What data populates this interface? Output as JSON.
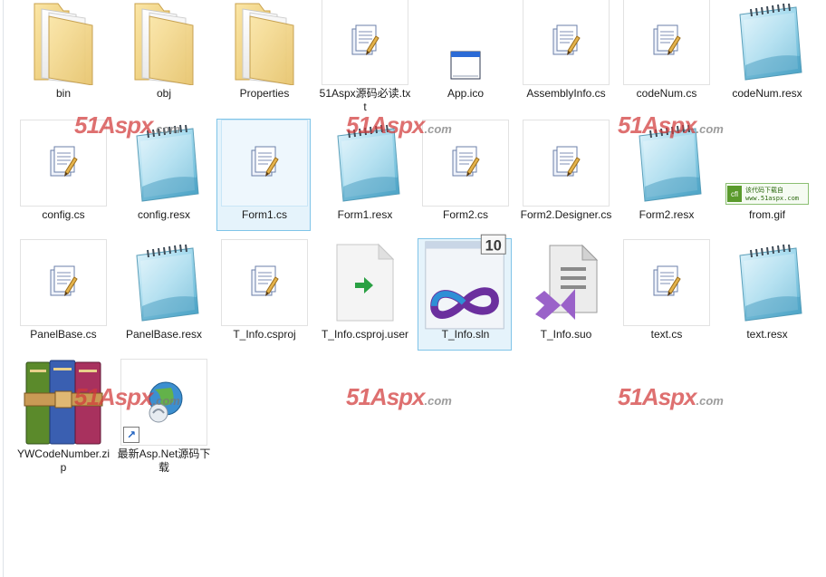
{
  "files": [
    {
      "label": "bin",
      "icon": "folder-icon"
    },
    {
      "label": "obj",
      "icon": "folder-icon"
    },
    {
      "label": "Properties",
      "icon": "folder-icon"
    },
    {
      "label": "51Aspx源码必读.txt",
      "icon": "document-icon"
    },
    {
      "label": "App.ico",
      "icon": "window-icon"
    },
    {
      "label": "AssemblyInfo.cs",
      "icon": "document-icon"
    },
    {
      "label": "codeNum.cs",
      "icon": "document-icon"
    },
    {
      "label": "codeNum.resx",
      "icon": "notepad-icon"
    },
    {
      "label": "config.cs",
      "icon": "document-icon"
    },
    {
      "label": "config.resx",
      "icon": "notepad-icon"
    },
    {
      "label": "Form1.cs",
      "icon": "document-icon"
    },
    {
      "label": "Form1.resx",
      "icon": "notepad-icon"
    },
    {
      "label": "Form2.cs",
      "icon": "document-icon"
    },
    {
      "label": "Form2.Designer.cs",
      "icon": "document-icon"
    },
    {
      "label": "Form2.resx",
      "icon": "notepad-icon"
    },
    {
      "label": "from.gif",
      "icon": "gif-icon",
      "gif_text_top": "该代码下载自",
      "gif_text_bottom": "www.51aspx.com"
    },
    {
      "label": "PanelBase.cs",
      "icon": "document-icon"
    },
    {
      "label": "PanelBase.resx",
      "icon": "notepad-icon"
    },
    {
      "label": "T_Info.csproj",
      "icon": "document-icon"
    },
    {
      "label": "T_Info.csproj.user",
      "icon": "user-file-icon"
    },
    {
      "label": "T_Info.sln",
      "icon": "visual-studio-solution-icon",
      "badge": "10"
    },
    {
      "label": "T_Info.suo",
      "icon": "visual-studio-file-icon"
    },
    {
      "label": "text.cs",
      "icon": "document-icon"
    },
    {
      "label": "text.resx",
      "icon": "notepad-icon"
    },
    {
      "label": "YWCodeNumber.zip",
      "icon": "winrar-icon"
    },
    {
      "label": "最新Asp.Net源码下载",
      "icon": "internet-shortcut-icon"
    }
  ],
  "selected": [
    "Form1.cs",
    "T_Info.sln"
  ],
  "watermark": {
    "main": "51Aspx",
    "suffix": ".com",
    "color": "#d23a3a"
  }
}
